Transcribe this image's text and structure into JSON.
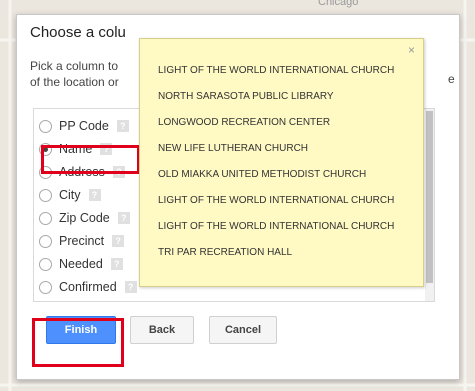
{
  "map": {
    "city_label": "Chicago"
  },
  "dialog": {
    "title": "Choose a colu",
    "description_lines": [
      "Pick a column to",
      "of the location or"
    ],
    "description_tail_char": "e",
    "options": [
      {
        "label": "PP Code",
        "checked": false
      },
      {
        "label": "Name",
        "checked": true
      },
      {
        "label": "Address",
        "checked": false
      },
      {
        "label": "City",
        "checked": false
      },
      {
        "label": "Zip Code",
        "checked": false
      },
      {
        "label": "Precinct",
        "checked": false
      },
      {
        "label": "Needed",
        "checked": false
      },
      {
        "label": "Confirmed",
        "checked": false
      }
    ],
    "help_glyph": "?",
    "buttons": {
      "finish": "Finish",
      "back": "Back",
      "cancel": "Cancel"
    }
  },
  "popup": {
    "close_glyph": "×",
    "items": [
      "LIGHT OF THE WORLD INTERNATIONAL CHURCH",
      "NORTH SARASOTA PUBLIC LIBRARY",
      "LONGWOOD RECREATION CENTER",
      "NEW LIFE LUTHERAN CHURCH",
      "OLD MIAKKA UNITED METHODIST CHURCH",
      "LIGHT OF THE WORLD INTERNATIONAL CHURCH",
      "LIGHT OF THE WORLD INTERNATIONAL CHURCH",
      "TRI PAR RECREATION HALL"
    ]
  }
}
